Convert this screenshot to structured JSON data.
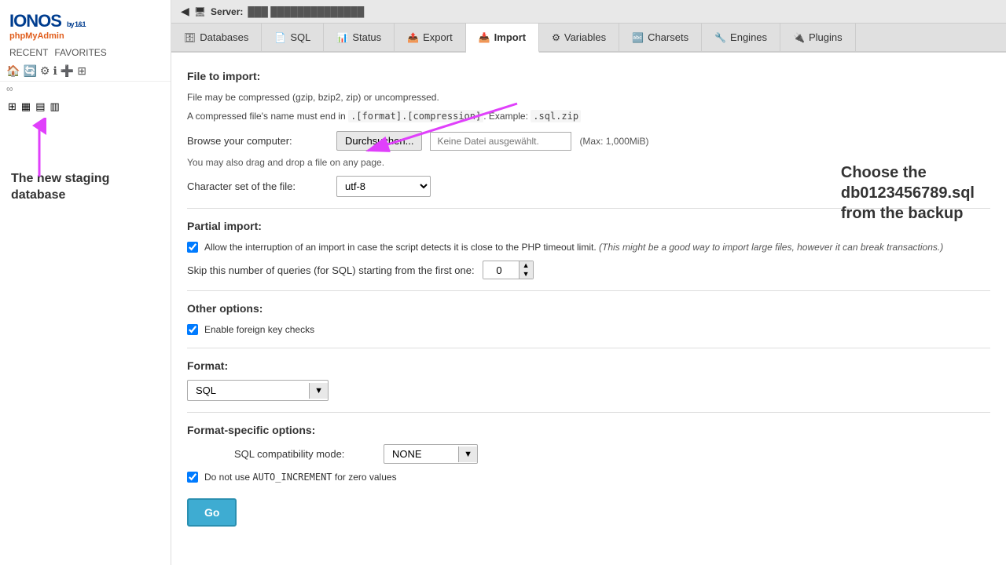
{
  "sidebar": {
    "logo": "IONOS",
    "logo_sub": "by 1&1",
    "pma": "phpMyAdmin",
    "recent": "RECENT",
    "favorites": "FAVORITES",
    "annotation_text": "The new staging database"
  },
  "topbar": {
    "server_label": "Server:",
    "server_info": "███ ██████████████"
  },
  "tabs": [
    {
      "id": "databases",
      "label": "Databases",
      "icon": "🗄"
    },
    {
      "id": "sql",
      "label": "SQL",
      "icon": "📄"
    },
    {
      "id": "status",
      "label": "Status",
      "icon": "📊"
    },
    {
      "id": "export",
      "label": "Export",
      "icon": "📤"
    },
    {
      "id": "import",
      "label": "Import",
      "icon": "📥",
      "active": true
    },
    {
      "id": "variables",
      "label": "Variables",
      "icon": "⚙"
    },
    {
      "id": "charsets",
      "label": "Charsets",
      "icon": "🔤"
    },
    {
      "id": "engines",
      "label": "Engines",
      "icon": "🔧"
    },
    {
      "id": "plugins",
      "label": "Plugins",
      "icon": "🔌"
    }
  ],
  "content": {
    "file_to_import": {
      "section_title": "File to import:",
      "desc1": "File may be compressed (gzip, bzip2, zip) or uncompressed.",
      "desc2": "A compressed file's name must end in .[format].[compression]. Example: .sql.zip",
      "browse_label": "Browse your computer:",
      "browse_btn": "Durchsuchen...",
      "no_file_text": "Keine Datei ausgewählt.",
      "max_label": "(Max: 1,000MiB)",
      "drag_note": "You may also drag and drop a file on any page.",
      "charset_label": "Character set of the file:",
      "charset_value": "utf-8"
    },
    "partial_import": {
      "section_title": "Partial import:",
      "checkbox_allow_interrupt": true,
      "allow_interrupt_label": "Allow the interruption of an import in case the script detects it is close to the PHP timeout limit.",
      "allow_interrupt_note": "(This might be a good way to import large files, however it can break transactions.)",
      "skip_label": "Skip this number of queries (for SQL) starting from the first one:",
      "skip_value": "0"
    },
    "other_options": {
      "section_title": "Other options:",
      "foreign_key_checks": true,
      "foreign_key_label": "Enable foreign key checks"
    },
    "format": {
      "section_title": "Format:",
      "format_value": "SQL"
    },
    "format_specific": {
      "section_title": "Format-specific options:",
      "compat_mode_label": "SQL compatibility mode:",
      "compat_mode_value": "NONE",
      "auto_increment_checked": true,
      "auto_increment_label": "Do not use AUTO_INCREMENT for zero values"
    },
    "go_button": "Go"
  },
  "annotation": {
    "choose_text": "Choose the\ndb0123456789.sql\nfrom the backup"
  }
}
